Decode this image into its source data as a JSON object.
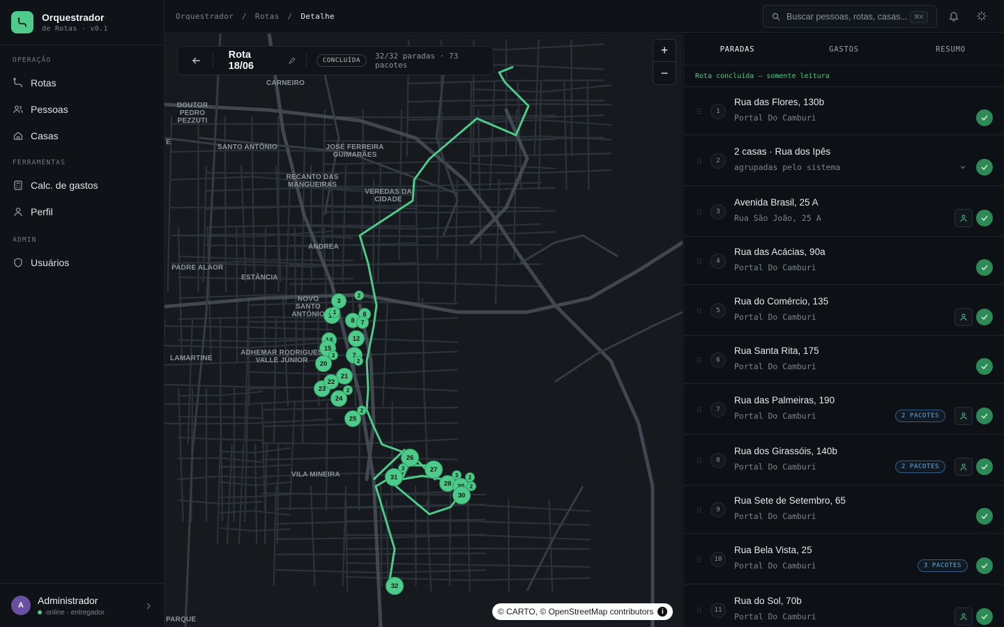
{
  "brand": {
    "title": "Orquestrador",
    "subtitle": "de Rotas · v0.1"
  },
  "nav": {
    "operacao_label": "OPERAÇÃO",
    "items_operacao": [
      {
        "label": "Rotas",
        "icon": "route-icon"
      },
      {
        "label": "Pessoas",
        "icon": "people-icon"
      },
      {
        "label": "Casas",
        "icon": "home-icon"
      }
    ],
    "ferramentas_label": "FERRAMENTAS",
    "items_ferramentas": [
      {
        "label": "Calc. de gastos",
        "icon": "calculator-icon"
      },
      {
        "label": "Perfil",
        "icon": "user-icon"
      }
    ],
    "admin_label": "ADMIN",
    "items_admin": [
      {
        "label": "Usuários",
        "icon": "shield-icon"
      }
    ]
  },
  "user": {
    "initial": "A",
    "name": "Administrador",
    "status": "online · entregador"
  },
  "breadcrumb": {
    "part1": "Orquestrador",
    "sep": "/",
    "part2": "Rotas",
    "current": "Detalhe"
  },
  "search": {
    "placeholder": "Buscar pessoas, rotas, casas...",
    "shortcut": "⌘K"
  },
  "route": {
    "title": "Rota 18/06",
    "status": "CONCLUÍDA",
    "meta": "32/32 paradas · 73 pacotes"
  },
  "map": {
    "zoom_in": "+",
    "zoom_out": "−",
    "attribution": "© CARTO, © OpenStreetMap contributors",
    "labels": {
      "carneiro": "CARNEIRO",
      "doutor": "DOUTOR PEDRO PEZZUTI",
      "santo_antonio": "SANTO ANTÔNIO",
      "jose_ferreira": "JOSÉ FERREIRA GUIMARÃES",
      "recanto": "RECANTO DAS MANGUEIRAS",
      "veredas": "VEREDAS DA CIDADE",
      "andrea": "ANDREA",
      "padre": "PADRE ALAOR",
      "estancia": "ESTÂNCIA",
      "novo_santo": "NOVO SANTO ANTÔNIO",
      "lamartine": "LAMARTINE",
      "adhemar": "ADHEMAR RODRIGUES VALLE JÚNIOR",
      "vila_mineira": "VILA MINEIRA",
      "parque": "PARQUE",
      "e": "E"
    },
    "pins": [
      "3",
      "2",
      "10",
      "8",
      "6",
      "7",
      "14",
      "12",
      "15",
      "3",
      "7",
      "20",
      "2",
      "21",
      "23",
      "22",
      "2",
      "24",
      "2",
      "25",
      "26",
      "3",
      "27",
      "31",
      "3",
      "2",
      "28",
      "20",
      "2",
      "30",
      "32",
      "1"
    ]
  },
  "panel": {
    "tabs": [
      "PARADAS",
      "GASTOS",
      "RESUMO"
    ],
    "notice": "Rota concluída — somente leitura",
    "stops": [
      {
        "num": "1",
        "title": "Rua das Flores, 130b",
        "sub": "Portal Do Camburi"
      },
      {
        "num": "2",
        "title": "2 casas · Rua dos Ipês",
        "sub": "agrupadas pelo sistema"
      },
      {
        "num": "3",
        "title": "Avenida Brasil, 25 A",
        "sub": "Rua São João, 25 A"
      },
      {
        "num": "4",
        "title": "Rua das Acácias, 90a",
        "sub": "Portal Do Camburi"
      },
      {
        "num": "5",
        "title": "Rua do Comércio, 135",
        "sub": "Portal Do Camburi"
      },
      {
        "num": "6",
        "title": "Rua Santa Rita, 175",
        "sub": "Portal Do Camburi"
      },
      {
        "num": "7",
        "title": "Rua das Palmeiras, 190",
        "sub": "Portal Do Camburi",
        "pkg": "2 PACOTES"
      },
      {
        "num": "8",
        "title": "Rua dos Girassóis, 140b",
        "sub": "Portal Do Camburi",
        "pkg": "2 PACOTES"
      },
      {
        "num": "9",
        "title": "Rua Sete de Setembro, 65",
        "sub": "Portal Do Camburi"
      },
      {
        "num": "10",
        "title": "Rua Bela Vista, 25",
        "sub": "Portal Do Camburi",
        "pkg": "3 PACOTES"
      },
      {
        "num": "11",
        "title": "Rua do Sol, 70b",
        "sub": "Portal Do Camburi"
      }
    ]
  },
  "colors": {
    "accent": "#4ecb8a",
    "check": "#2d8a57",
    "package": "#6aa9d8"
  }
}
